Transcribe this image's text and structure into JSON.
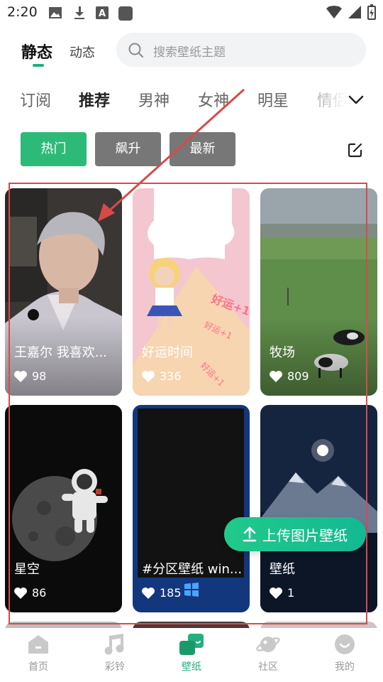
{
  "status_bar": {
    "time": "2:20"
  },
  "header": {
    "tab_static": "静态",
    "tab_dynamic": "动态",
    "search_placeholder": "搜索壁纸主题"
  },
  "categories": [
    "订阅",
    "推荐",
    "男神",
    "女神",
    "明星",
    "情侣"
  ],
  "active_category": "推荐",
  "filters": {
    "hot": "热门",
    "rise": "飙升",
    "new": "最新"
  },
  "wallpapers": [
    {
      "title": "王嘉尔 我喜欢...",
      "likes": "98"
    },
    {
      "title": "好运时间",
      "likes": "336"
    },
    {
      "title": "牧场",
      "likes": "809"
    },
    {
      "title": "星空",
      "likes": "86"
    },
    {
      "title": "#分区壁纸 win...",
      "likes": "185"
    },
    {
      "title": "壁纸",
      "likes": "1"
    }
  ],
  "upload_button": "上传图片壁纸",
  "bottom_nav": [
    {
      "label": "首页",
      "icon": "home-icon"
    },
    {
      "label": "彩铃",
      "icon": "music-icon"
    },
    {
      "label": "壁纸",
      "icon": "wallpaper-icon"
    },
    {
      "label": "社区",
      "icon": "planet-icon"
    },
    {
      "label": "我的",
      "icon": "profile-icon"
    }
  ],
  "colors": {
    "accent": "#22b07d",
    "annotation": "#d84a4a",
    "inactive_button": "#777777"
  }
}
